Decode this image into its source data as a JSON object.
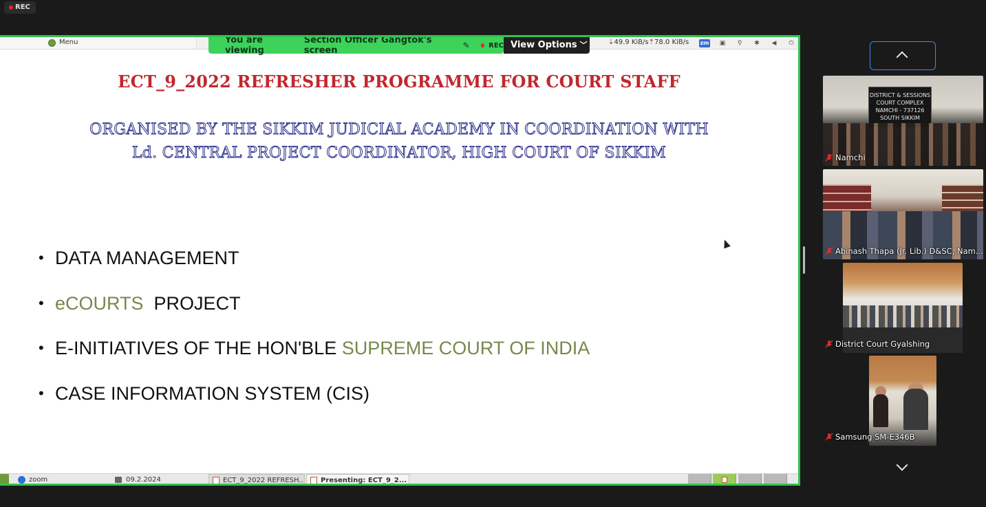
{
  "recording": {
    "label": "REC"
  },
  "desktop": {
    "menu_label": "Menu",
    "net_down": "49.9 KiB/s",
    "net_up": "78.0 KiB/s",
    "zoom_tray": "zm"
  },
  "share_banner": {
    "viewing_prefix": "You are viewing",
    "sharer_screen": "Section Officer Gangtok's screen",
    "rec_label": "REC",
    "view_options_label": "View Options"
  },
  "slide": {
    "title": "ECT_9_2022 REFRESHER PROGRAMME FOR COURT STAFF",
    "subtitle_line1": "ORGANISED BY THE SIKKIM JUDICIAL ACADEMY IN COORDINATION WITH",
    "subtitle_line2": "Ld. CENTRAL PROJECT COORDINATOR, HIGH COURT OF SIKKIM",
    "bullets": [
      {
        "plain": "DATA MANAGEMENT"
      },
      {
        "green": "eCOURTS",
        "plain_after": "PROJECT"
      },
      {
        "plain_before": "E-INITIATIVES OF THE HON'BLE",
        "green": "SUPREME COURT OF INDIA"
      },
      {
        "plain": "CASE INFORMATION SYSTEM (CIS)"
      }
    ],
    "bullet_glyph": "•"
  },
  "taskbar": {
    "zoom_label": "zoom",
    "date_label": "09.2.2024",
    "window1_label": "ECT_9_2022 REFRESH...",
    "window2_label": "Presenting: ECT_9_2..."
  },
  "participants": [
    {
      "name": "Namchi",
      "muted": true,
      "sign_lines": [
        "DISTRICT & SESSIONS",
        "COURT COMPLEX",
        "NAMCHI - 737126",
        "SOUTH SIKKIM"
      ]
    },
    {
      "name": "Abinash Thapa (Jr. Lib.) D&SC, Nam...",
      "muted": true
    },
    {
      "name": "District Court Gyalshing",
      "muted": true
    },
    {
      "name": "Samsung SM-E346B",
      "muted": true
    }
  ]
}
